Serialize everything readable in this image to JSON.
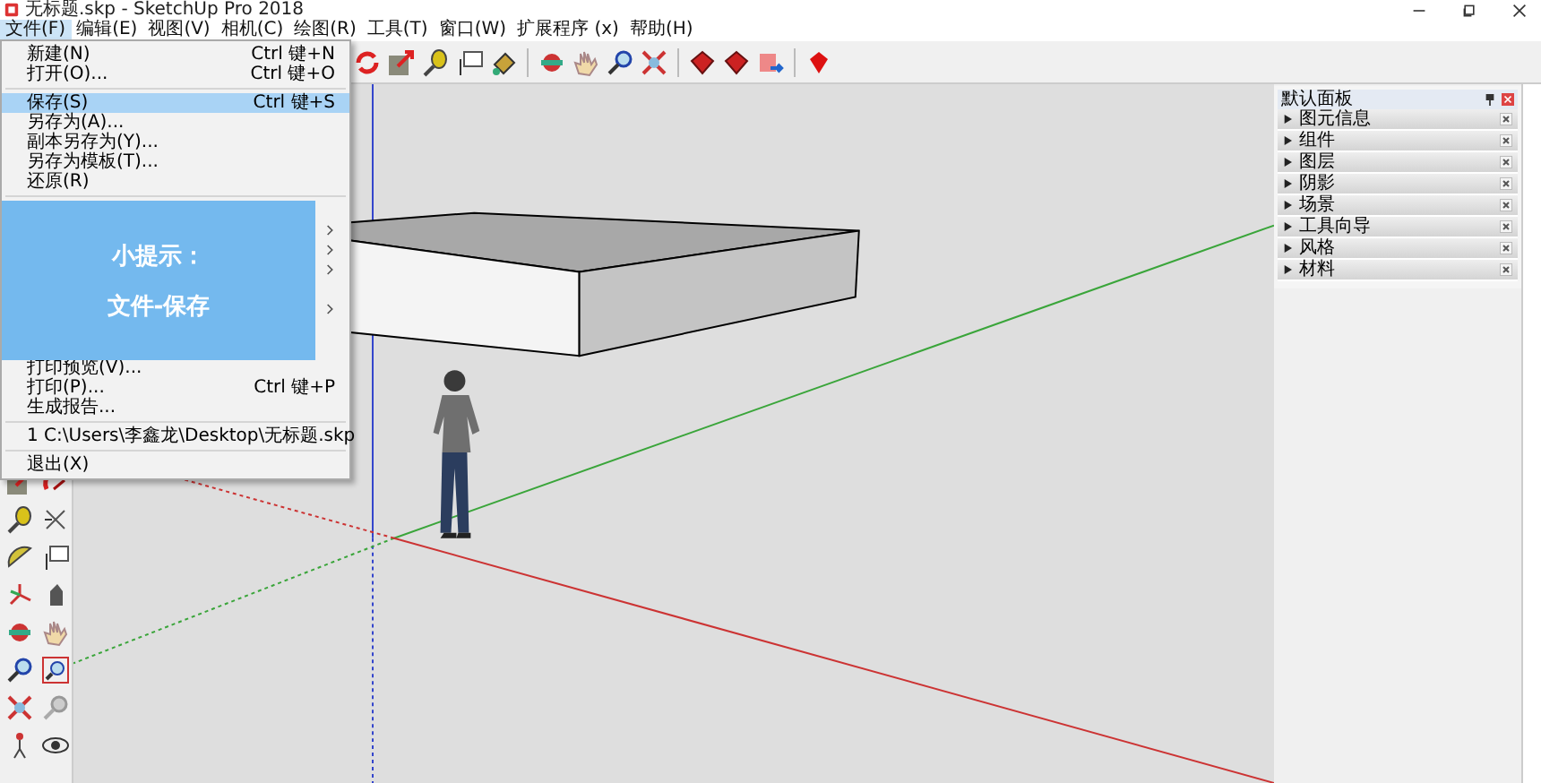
{
  "window": {
    "title": "无标题.skp - SketchUp Pro 2018"
  },
  "menu_bar": [
    {
      "label": "文件(F)",
      "selected": true
    },
    {
      "label": "编辑(E)",
      "selected": false
    },
    {
      "label": "视图(V)",
      "selected": false
    },
    {
      "label": "相机(C)",
      "selected": false
    },
    {
      "label": "绘图(R)",
      "selected": false
    },
    {
      "label": "工具(T)",
      "selected": false
    },
    {
      "label": "窗口(W)",
      "selected": false
    },
    {
      "label": "扩展程序 (x)",
      "selected": false
    },
    {
      "label": "帮助(H)",
      "selected": false
    }
  ],
  "file_menu": {
    "items": [
      {
        "kind": "item",
        "label": "新建(N)",
        "shortcut": "Ctrl 键+N",
        "selected": false
      },
      {
        "kind": "item",
        "label": "打开(O)...",
        "shortcut": "Ctrl 键+O",
        "selected": false
      },
      {
        "kind": "separator"
      },
      {
        "kind": "item",
        "label": "保存(S)",
        "shortcut": "Ctrl 键+S",
        "selected": true
      },
      {
        "kind": "item",
        "label": "另存为(A)...",
        "selected": false
      },
      {
        "kind": "item",
        "label": "副本另存为(Y)...",
        "selected": false
      },
      {
        "kind": "item",
        "label": "另存为模板(T)...",
        "selected": false
      },
      {
        "kind": "item",
        "label": "还原(R)",
        "selected": false
      },
      {
        "kind": "separator"
      },
      {
        "kind": "covered"
      },
      {
        "kind": "covered_submenu"
      },
      {
        "kind": "covered_submenu"
      },
      {
        "kind": "covered_submenu"
      },
      {
        "kind": "covered"
      },
      {
        "kind": "covered_submenu"
      },
      {
        "kind": "covered"
      },
      {
        "kind": "covered"
      },
      {
        "kind": "item",
        "label": "打印预览(V)...",
        "selected": false
      },
      {
        "kind": "item",
        "label": "打印(P)...",
        "shortcut": "Ctrl 键+P",
        "selected": false
      },
      {
        "kind": "item",
        "label": "生成报告...",
        "selected": false
      },
      {
        "kind": "separator"
      },
      {
        "kind": "item",
        "label": "1 C:\\Users\\李鑫龙\\Desktop\\无标题.skp",
        "selected": false
      },
      {
        "kind": "separator"
      },
      {
        "kind": "item",
        "label": "退出(X)",
        "selected": false
      }
    ]
  },
  "tip": {
    "lines": [
      "小提示：",
      "文件-保存"
    ]
  },
  "tray": {
    "title": "默认面板",
    "panels": [
      {
        "label": "图元信息"
      },
      {
        "label": "组件"
      },
      {
        "label": "图层"
      },
      {
        "label": "阴影"
      },
      {
        "label": "场景"
      },
      {
        "label": "工具向导"
      },
      {
        "label": "风格"
      },
      {
        "label": "材料"
      }
    ]
  }
}
